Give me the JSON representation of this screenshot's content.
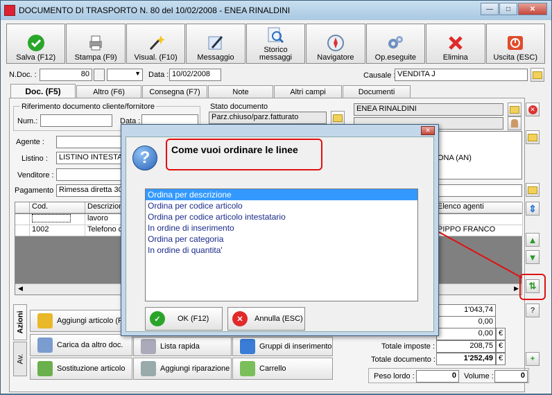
{
  "window": {
    "title": "DOCUMENTO DI TRASPORTO N. 80  del 10/02/2008 - ENEA RINALDINI"
  },
  "toolbar": [
    {
      "label": "Salva (F12)",
      "icon": "check-icon"
    },
    {
      "label": "Stampa (F9)",
      "icon": "printer-icon"
    },
    {
      "label": "Visual. (F10)",
      "icon": "magic-wand-icon"
    },
    {
      "label": "Messaggio",
      "icon": "pen-icon"
    },
    {
      "label": "Storico messaggi",
      "icon": "search-doc-icon"
    },
    {
      "label": "Navigatore",
      "icon": "compass-icon"
    },
    {
      "label": "Op.eseguite",
      "icon": "gears-icon"
    },
    {
      "label": "Elimina",
      "icon": "x-icon"
    },
    {
      "label": "Uscita (ESC)",
      "icon": "exit-icon"
    }
  ],
  "header": {
    "ndoc_label": "N.Doc. :",
    "ndoc_value": "80",
    "data_label": "Data :",
    "data_value": "10/02/2008",
    "causale_label": "Causale :",
    "causale_value": "VENDITA J"
  },
  "tabs": [
    "Doc. (F5)",
    "Altro (F6)",
    "Consegna (F7)",
    "Note",
    "Altri campi",
    "Documenti"
  ],
  "doc": {
    "rif_label": "Riferimento documento cliente/fornitore",
    "num_label": "Num.:",
    "data_label": "Data :",
    "stato_label": "Stato documento",
    "stato_value": "Parz.chiuso/parz.fatturato",
    "cliente": "ENEA RINALDINI",
    "cliente_city": "ONA (AN)",
    "agente_label": "Agente :",
    "listino_label": "Listino :",
    "listino_value": "LISTINO INTESTA",
    "venditore_label": "Venditore :",
    "pagamento_label": "Pagamento :",
    "pagamento_value": "Rimessa diretta 30"
  },
  "grid": {
    "headers": [
      "Cod.",
      "Descrizion",
      "Elenco agenti"
    ],
    "rows": [
      [
        "",
        "lavoro",
        ""
      ],
      [
        "1002",
        "Telefono c",
        "PIPPO FRANCO"
      ]
    ]
  },
  "actions": {
    "side_tabs": [
      "Azioni",
      "Av."
    ],
    "buttons": [
      "Aggiungi articolo (F",
      "Carica da altro doc.",
      "Lista rapida",
      "Gruppi di inserimento",
      "Sostituzione articolo",
      "Aggiungi riparazione",
      "Carrello"
    ]
  },
  "totals": {
    "v1": "1'043,74",
    "v2": "0,00",
    "v3": "0,00",
    "imposte_label": "Totale imposte :",
    "imposte": "208,75",
    "documento_label": "Totale documento :",
    "documento": "1'252,49",
    "euro": "€",
    "help": "?",
    "peso_label": "Peso lordo :",
    "peso": "0",
    "volume_label": "Volume :",
    "volume": "0"
  },
  "dialog": {
    "question": "Come vuoi ordinare le linee",
    "options": [
      "Ordina per descrizione",
      "Ordina per codice articolo",
      "Ordina per codice articolo intestatario",
      "In ordine di inserimento",
      "Ordina per categoria",
      "In ordine di quantita'"
    ],
    "ok_label": "OK (F12)",
    "cancel_label": "Annulla (ESC)"
  }
}
